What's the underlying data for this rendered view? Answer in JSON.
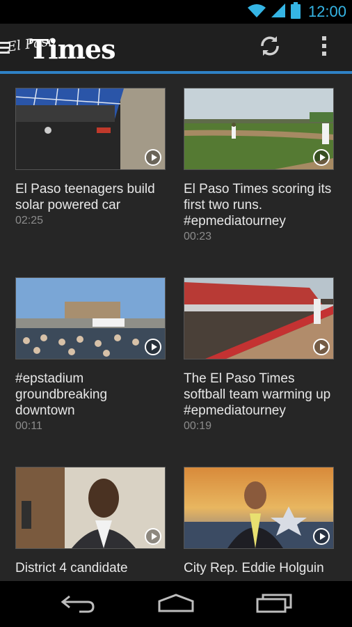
{
  "status_bar": {
    "time": "12:00",
    "icons": [
      "wifi-icon",
      "signal-icon",
      "battery-icon"
    ]
  },
  "action_bar": {
    "logo_small": "El Paso",
    "logo_large": "Times",
    "icons": [
      "menu-icon",
      "refresh-icon",
      "overflow-menu-icon"
    ]
  },
  "videos": [
    {
      "title": "El Paso teenagers build solar powered car",
      "duration": "02:25"
    },
    {
      "title": "El Paso Times scoring its first two runs. #epmediatourney",
      "duration": "00:23"
    },
    {
      "title": "#epstadium groundbreaking downtown",
      "duration": "00:11"
    },
    {
      "title": "The El Paso Times softball team warming up #epmediatourney",
      "duration": "00:19"
    },
    {
      "title": "District 4 candidate",
      "duration": ""
    },
    {
      "title": "City Rep. Eddie Holguin",
      "duration": ""
    }
  ],
  "nav_bar": {
    "icons": [
      "back-icon",
      "home-icon",
      "recent-apps-icon"
    ]
  },
  "colors": {
    "accent": "#2f82c6",
    "time": "#35b5e5",
    "background": "#262626"
  }
}
